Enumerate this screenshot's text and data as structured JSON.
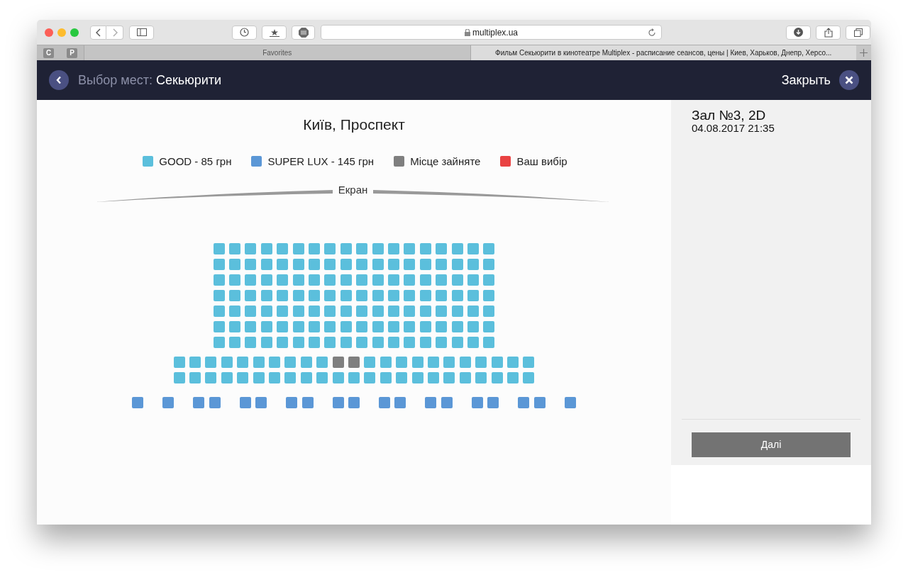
{
  "browser": {
    "url": "multiplex.ua",
    "pinned_tabs": [
      "C",
      "P"
    ],
    "tabs": [
      {
        "title": "Favorites",
        "selected": false
      },
      {
        "title": "Фильм Секьюрити в кинотеатре Multiplex - расписание сеансов, цены | Киев, Харьков, Днепр, Херсо...",
        "selected": true
      }
    ]
  },
  "header": {
    "title_label": "Выбор мест:",
    "title_value": "Секьюрити",
    "close_label": "Закрыть"
  },
  "main": {
    "cinema": "Київ, Проспект",
    "legend": [
      {
        "label": "GOOD - 85 грн",
        "color": "#5bbfdc"
      },
      {
        "label": "SUPER LUX - 145 грн",
        "color": "#5b97d6"
      },
      {
        "label": "Місце зайняте",
        "color": "#7f7f7f"
      },
      {
        "label": "Ваш вибір",
        "color": "#e94242"
      }
    ],
    "screen_label": "Екран",
    "blocks": [
      {
        "kind": "good",
        "rows": [
          [
            [
              {
                "occupied": false
              },
              {
                "occupied": false
              },
              {
                "occupied": false
              },
              {
                "occupied": false
              },
              {
                "occupied": false
              },
              {
                "occupied": false
              },
              {
                "occupied": false
              },
              {
                "occupied": false
              },
              {
                "occupied": false
              },
              {
                "occupied": false
              },
              {
                "occupied": false
              },
              {
                "occupied": false
              },
              {
                "occupied": false
              },
              {
                "occupied": false
              },
              {
                "occupied": false
              },
              {
                "occupied": false
              },
              {
                "occupied": false
              },
              {
                "occupied": false
              }
            ]
          ],
          [
            [
              {
                "occupied": false
              },
              {
                "occupied": false
              },
              {
                "occupied": false
              },
              {
                "occupied": false
              },
              {
                "occupied": false
              },
              {
                "occupied": false
              },
              {
                "occupied": false
              },
              {
                "occupied": false
              },
              {
                "occupied": false
              },
              {
                "occupied": false
              },
              {
                "occupied": false
              },
              {
                "occupied": false
              },
              {
                "occupied": false
              },
              {
                "occupied": false
              },
              {
                "occupied": false
              },
              {
                "occupied": false
              },
              {
                "occupied": false
              },
              {
                "occupied": false
              }
            ]
          ],
          [
            [
              {
                "occupied": false
              },
              {
                "occupied": false
              },
              {
                "occupied": false
              },
              {
                "occupied": false
              },
              {
                "occupied": false
              },
              {
                "occupied": false
              },
              {
                "occupied": false
              },
              {
                "occupied": false
              },
              {
                "occupied": false
              },
              {
                "occupied": false
              },
              {
                "occupied": false
              },
              {
                "occupied": false
              },
              {
                "occupied": false
              },
              {
                "occupied": false
              },
              {
                "occupied": false
              },
              {
                "occupied": false
              },
              {
                "occupied": false
              },
              {
                "occupied": false
              }
            ]
          ],
          [
            [
              {
                "occupied": false
              },
              {
                "occupied": false
              },
              {
                "occupied": false
              },
              {
                "occupied": false
              },
              {
                "occupied": false
              },
              {
                "occupied": false
              },
              {
                "occupied": false
              },
              {
                "occupied": false
              },
              {
                "occupied": false
              },
              {
                "occupied": false
              },
              {
                "occupied": false
              },
              {
                "occupied": false
              },
              {
                "occupied": false
              },
              {
                "occupied": false
              },
              {
                "occupied": false
              },
              {
                "occupied": false
              },
              {
                "occupied": false
              },
              {
                "occupied": false
              }
            ]
          ],
          [
            [
              {
                "occupied": false
              },
              {
                "occupied": false
              },
              {
                "occupied": false
              },
              {
                "occupied": false
              },
              {
                "occupied": false
              },
              {
                "occupied": false
              },
              {
                "occupied": false
              },
              {
                "occupied": false
              },
              {
                "occupied": false
              },
              {
                "occupied": false
              },
              {
                "occupied": false
              },
              {
                "occupied": false
              },
              {
                "occupied": false
              },
              {
                "occupied": false
              },
              {
                "occupied": false
              },
              {
                "occupied": false
              },
              {
                "occupied": false
              },
              {
                "occupied": false
              }
            ]
          ],
          [
            [
              {
                "occupied": false
              },
              {
                "occupied": false
              },
              {
                "occupied": false
              },
              {
                "occupied": false
              },
              {
                "occupied": false
              },
              {
                "occupied": false
              },
              {
                "occupied": false
              },
              {
                "occupied": false
              },
              {
                "occupied": false
              },
              {
                "occupied": false
              },
              {
                "occupied": false
              },
              {
                "occupied": false
              },
              {
                "occupied": false
              },
              {
                "occupied": false
              },
              {
                "occupied": false
              },
              {
                "occupied": false
              },
              {
                "occupied": false
              },
              {
                "occupied": false
              }
            ]
          ],
          [
            [
              {
                "occupied": false
              },
              {
                "occupied": false
              },
              {
                "occupied": false
              },
              {
                "occupied": false
              },
              {
                "occupied": false
              },
              {
                "occupied": false
              },
              {
                "occupied": false
              },
              {
                "occupied": false
              },
              {
                "occupied": false
              },
              {
                "occupied": false
              },
              {
                "occupied": false
              },
              {
                "occupied": false
              },
              {
                "occupied": false
              },
              {
                "occupied": false
              },
              {
                "occupied": false
              },
              {
                "occupied": false
              },
              {
                "occupied": false
              },
              {
                "occupied": false
              }
            ]
          ]
        ]
      },
      {
        "kind": "good",
        "rows": [
          [
            [
              {
                "occupied": false
              },
              {
                "occupied": false
              },
              {
                "occupied": false
              },
              {
                "occupied": false
              },
              {
                "occupied": false
              },
              {
                "occupied": false
              },
              {
                "occupied": false
              },
              {
                "occupied": false
              },
              {
                "occupied": false
              },
              {
                "occupied": false
              },
              {
                "occupied": true
              },
              {
                "occupied": true
              },
              {
                "occupied": false
              },
              {
                "occupied": false
              },
              {
                "occupied": false
              },
              {
                "occupied": false
              },
              {
                "occupied": false
              },
              {
                "occupied": false
              },
              {
                "occupied": false
              },
              {
                "occupied": false
              },
              {
                "occupied": false
              },
              {
                "occupied": false
              },
              {
                "occupied": false
              }
            ]
          ],
          [
            [
              {
                "occupied": false
              },
              {
                "occupied": false
              },
              {
                "occupied": false
              },
              {
                "occupied": false
              },
              {
                "occupied": false
              },
              {
                "occupied": false
              },
              {
                "occupied": false
              },
              {
                "occupied": false
              },
              {
                "occupied": false
              },
              {
                "occupied": false
              },
              {
                "occupied": false
              },
              {
                "occupied": false
              },
              {
                "occupied": false
              },
              {
                "occupied": false
              },
              {
                "occupied": false
              },
              {
                "occupied": false
              },
              {
                "occupied": false
              },
              {
                "occupied": false
              },
              {
                "occupied": false
              },
              {
                "occupied": false
              },
              {
                "occupied": false
              },
              {
                "occupied": false
              },
              {
                "occupied": false
              }
            ]
          ]
        ]
      },
      {
        "kind": "super_lux",
        "rows": [
          [
            [
              {
                "occupied": false
              }
            ],
            [
              {
                "occupied": false
              }
            ],
            [
              {
                "occupied": false
              },
              {
                "occupied": false
              }
            ],
            [
              {
                "occupied": false
              },
              {
                "occupied": false
              }
            ],
            [
              {
                "occupied": false
              },
              {
                "occupied": false
              }
            ],
            [
              {
                "occupied": false
              },
              {
                "occupied": false
              }
            ],
            [
              {
                "occupied": false
              },
              {
                "occupied": false
              }
            ],
            [
              {
                "occupied": false
              },
              {
                "occupied": false
              }
            ],
            [
              {
                "occupied": false
              },
              {
                "occupied": false
              }
            ],
            [
              {
                "occupied": false
              },
              {
                "occupied": false
              }
            ],
            [
              {
                "occupied": false
              }
            ]
          ]
        ]
      }
    ]
  },
  "side": {
    "hall": "Зал №3, 2D",
    "datetime": "04.08.2017 21:35",
    "next_button": "Далі"
  }
}
